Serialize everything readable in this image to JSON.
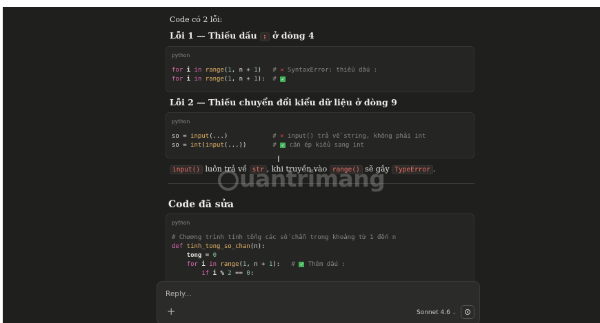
{
  "intro": "Code có 2 lỗi:",
  "error1": {
    "prefix": "Lỗi 1 — Thiếu dấu ",
    "code": ":",
    "suffix": " ở dòng 4",
    "block": {
      "lang": "python",
      "l1_kw1": "for",
      "l1_var": " i ",
      "l1_kw2": "in",
      "l1_fn": " range",
      "l1_args_a": "(",
      "l1_n1": "1",
      "l1_args_b": ", n + ",
      "l1_n2": "1",
      "l1_args_c": ")",
      "l1_comment_a": "   # ",
      "l1_x": "✕",
      "l1_comment_b": " SyntaxError: thiếu dấu :",
      "l2_kw1": "for",
      "l2_var": " i ",
      "l2_kw2": "in",
      "l2_fn": " range",
      "l2_args_a": "(",
      "l2_n1": "1",
      "l2_args_b": ", n + ",
      "l2_n2": "1",
      "l2_args_c": "):",
      "l2_comment_a": "  # ",
      "l2_check": "✓"
    }
  },
  "error2": {
    "title": "Lỗi 2 — Thiếu chuyển đổi kiểu dữ liệu ở dòng 9",
    "block": {
      "lang": "python",
      "l1_a": "so = ",
      "l1_fn": "input",
      "l1_b": "(...)",
      "l1_comment_a": "            # ",
      "l1_x": "✕",
      "l1_comment_b": " input() trả về string, không phải int",
      "l2_a": "so = ",
      "l2_fn1": "int",
      "l2_b": "(",
      "l2_fn2": "input",
      "l2_c": "(...))",
      "l2_comment_a": "       # ",
      "l2_check": "✓",
      "l2_comment_b": " cần ép kiểu sang int"
    }
  },
  "explain": {
    "code1": "input()",
    "t1": " luôn trả về ",
    "code2": "str",
    "t2": ", khi truyền vào ",
    "code3": "range()",
    "t3": " sẽ gây ",
    "code4": "TypeError",
    "t4": "."
  },
  "fixed": {
    "title": "Code đã sửa",
    "lang": "python",
    "l1": "# Chương trình tính tổng các số chẵn trong khoảng từ 1 đến n",
    "l2_kw": "def",
    "l2_fn": " tinh_tong_so_chan",
    "l2_b": "(n):",
    "l3_a": "    tong = ",
    "l3_n": "0",
    "l4_a": "    ",
    "l4_kw1": "for",
    "l4_var": " i ",
    "l4_kw2": "in",
    "l4_fn": " range",
    "l4_b": "(",
    "l4_n1": "1",
    "l4_c": ", n + ",
    "l4_n2": "1",
    "l4_d": "):",
    "l4_comment_a": "   # ",
    "l4_check": "✓",
    "l4_comment_b": " Thêm dấu :",
    "l5_a": "        ",
    "l5_kw": "if",
    "l5_b": " i % ",
    "l5_n1": "2",
    "l5_c": " == ",
    "l5_n2": "0",
    "l5_d": ":"
  },
  "watermark": "uantrimang",
  "reply": {
    "placeholder": "Reply...",
    "plus": "+",
    "model": "Sonnet 4.6",
    "chevron": "⌄"
  }
}
